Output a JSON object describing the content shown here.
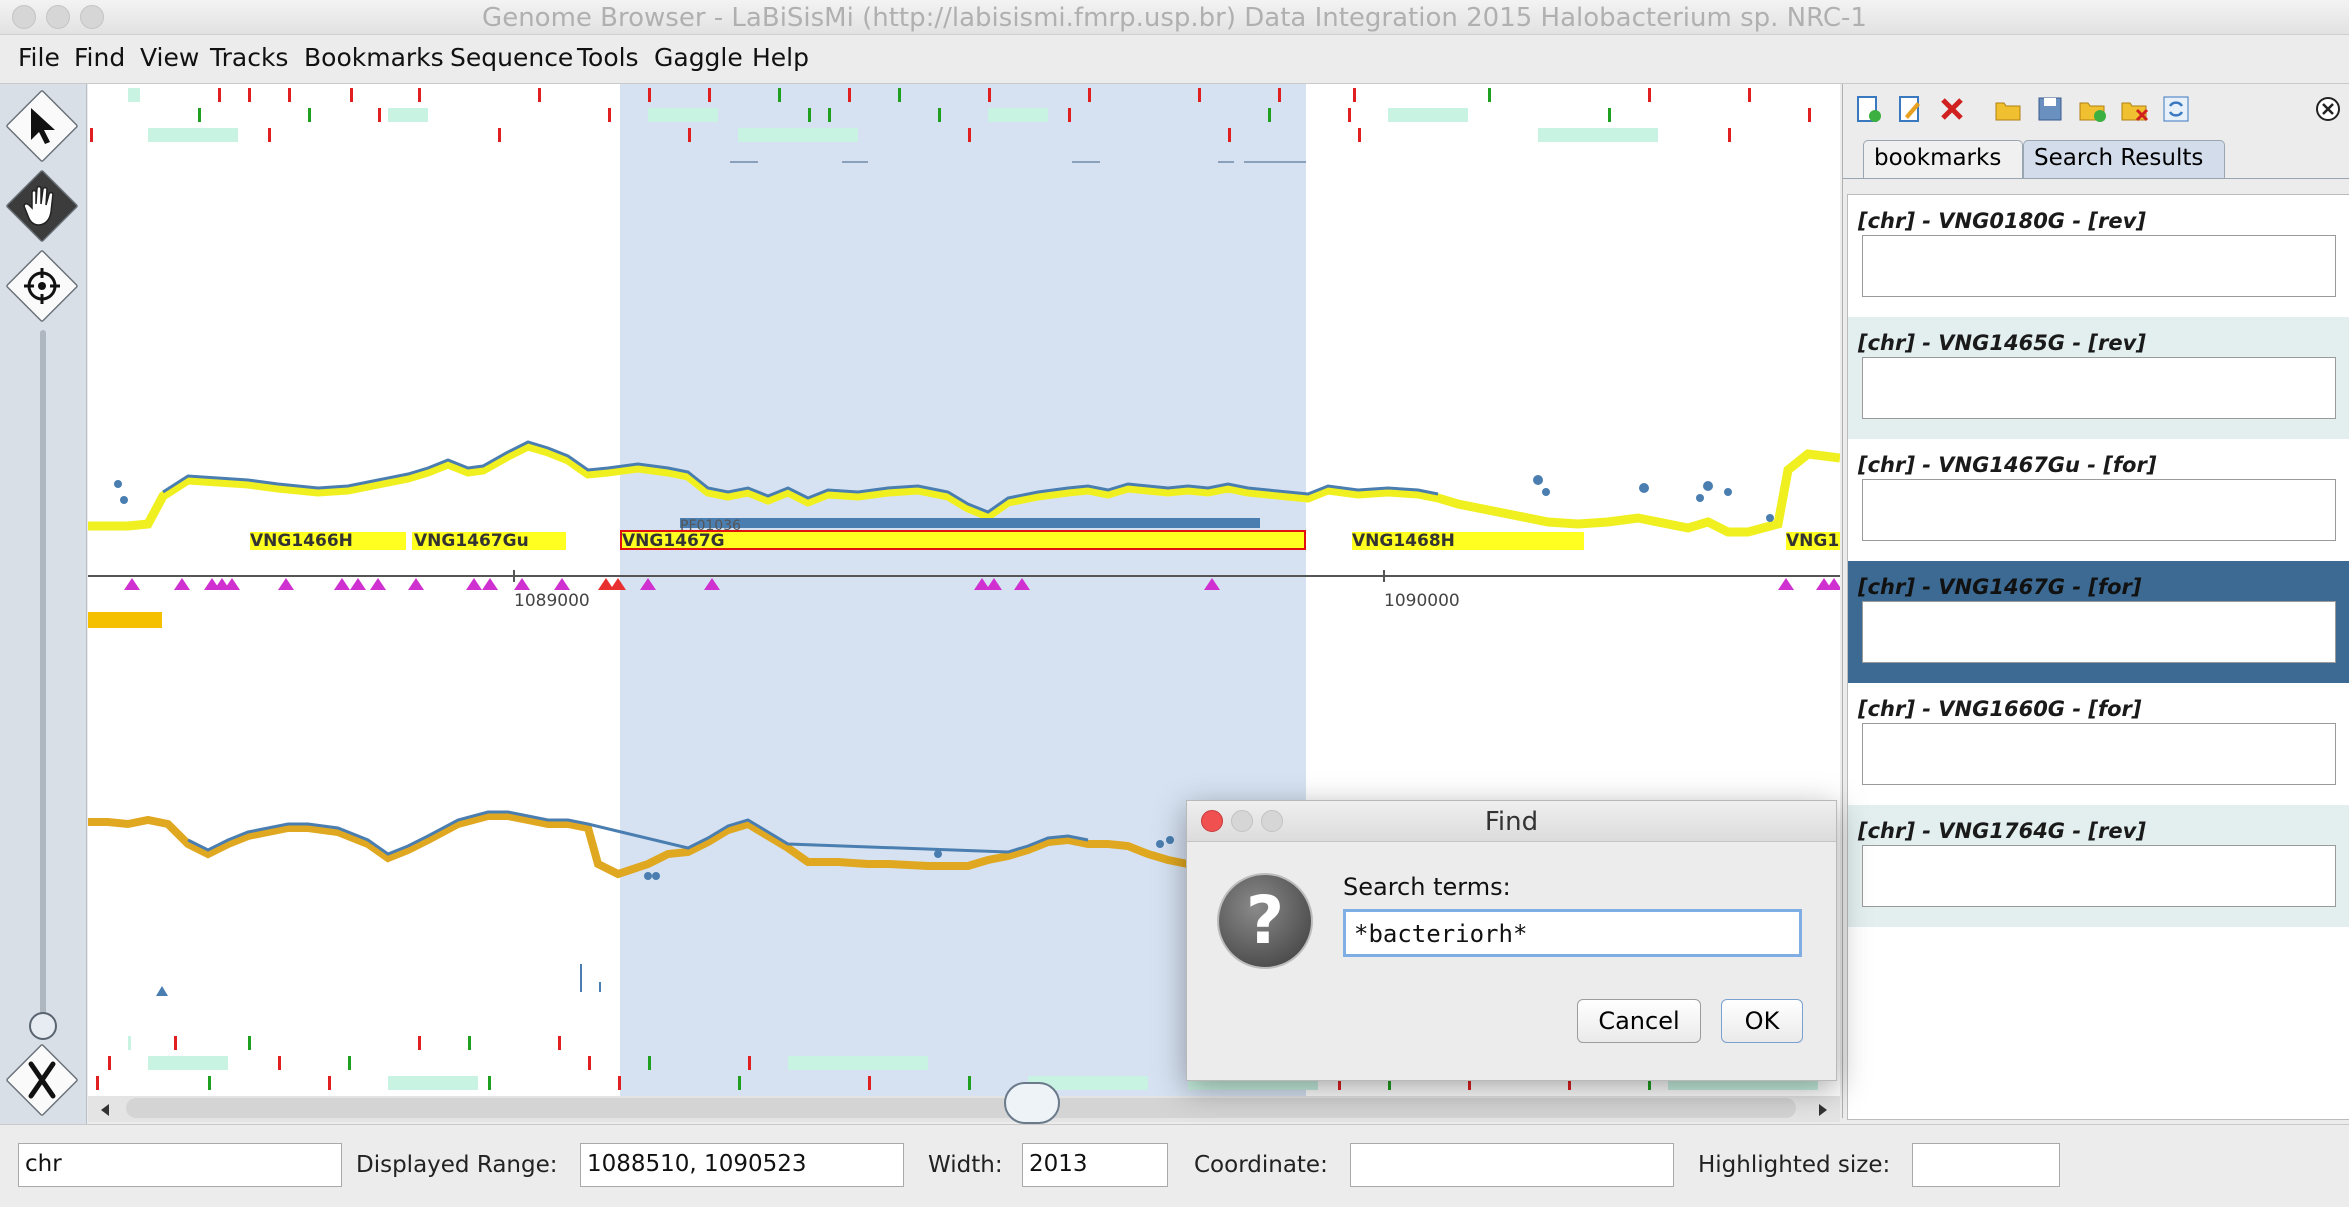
{
  "window": {
    "title": "Genome Browser - LaBiSisMi (http://labisismi.fmrp.usp.br) Data Integration 2015 Halobacterium sp. NRC-1"
  },
  "menu": [
    "File",
    "Find",
    "View",
    "Tracks",
    "Bookmarks",
    "Sequence",
    "Tools",
    "Gaggle",
    "Help"
  ],
  "tools": {
    "arrow": "arrow-select-icon",
    "hand": "hand-pan-icon",
    "crosshair": "crosshair-icon",
    "scissors": "zoom-out-x-icon"
  },
  "track": {
    "genes": [
      {
        "label": "VNG1466H"
      },
      {
        "label": "VNG1467Gu"
      },
      {
        "label": "VNG1467G"
      },
      {
        "label": "VNG1468H"
      },
      {
        "label": "VNG1"
      }
    ],
    "feature_label": "PF01036",
    "ticks": [
      "1089000",
      "1090000"
    ]
  },
  "status": {
    "chromosome": "chr",
    "range_label": "Displayed Range:",
    "range_value": "1088510, 1090523",
    "width_label": "Width:",
    "width_value": "2013",
    "coordinate_label": "Coordinate:",
    "coordinate_value": "",
    "highlight_label": "Highlighted size:",
    "highlight_value": ""
  },
  "panel": {
    "tabs": [
      "bookmarks",
      "Search Results"
    ],
    "active_tab": "Search Results",
    "results": [
      {
        "title": "[chr] - VNG0180G - [rev]",
        "selected": false
      },
      {
        "title": "[chr] - VNG1465G - [rev]",
        "selected": false
      },
      {
        "title": "[chr] - VNG1467Gu - [for]",
        "selected": false
      },
      {
        "title": "[chr] - VNG1467G - [for]",
        "selected": true
      },
      {
        "title": "[chr] - VNG1660G - [for]",
        "selected": false
      },
      {
        "title": "[chr] - VNG1764G - [rev]",
        "selected": false
      }
    ]
  },
  "dialog": {
    "title": "Find",
    "label": "Search terms:",
    "value": "*bacteriorh*",
    "cancel": "Cancel",
    "ok": "OK"
  },
  "colors": {
    "selection": "#d6e2f2",
    "gene_fill": "#ffff20",
    "result_selected": "#3d6a92",
    "result_alt": "#e3efef"
  }
}
